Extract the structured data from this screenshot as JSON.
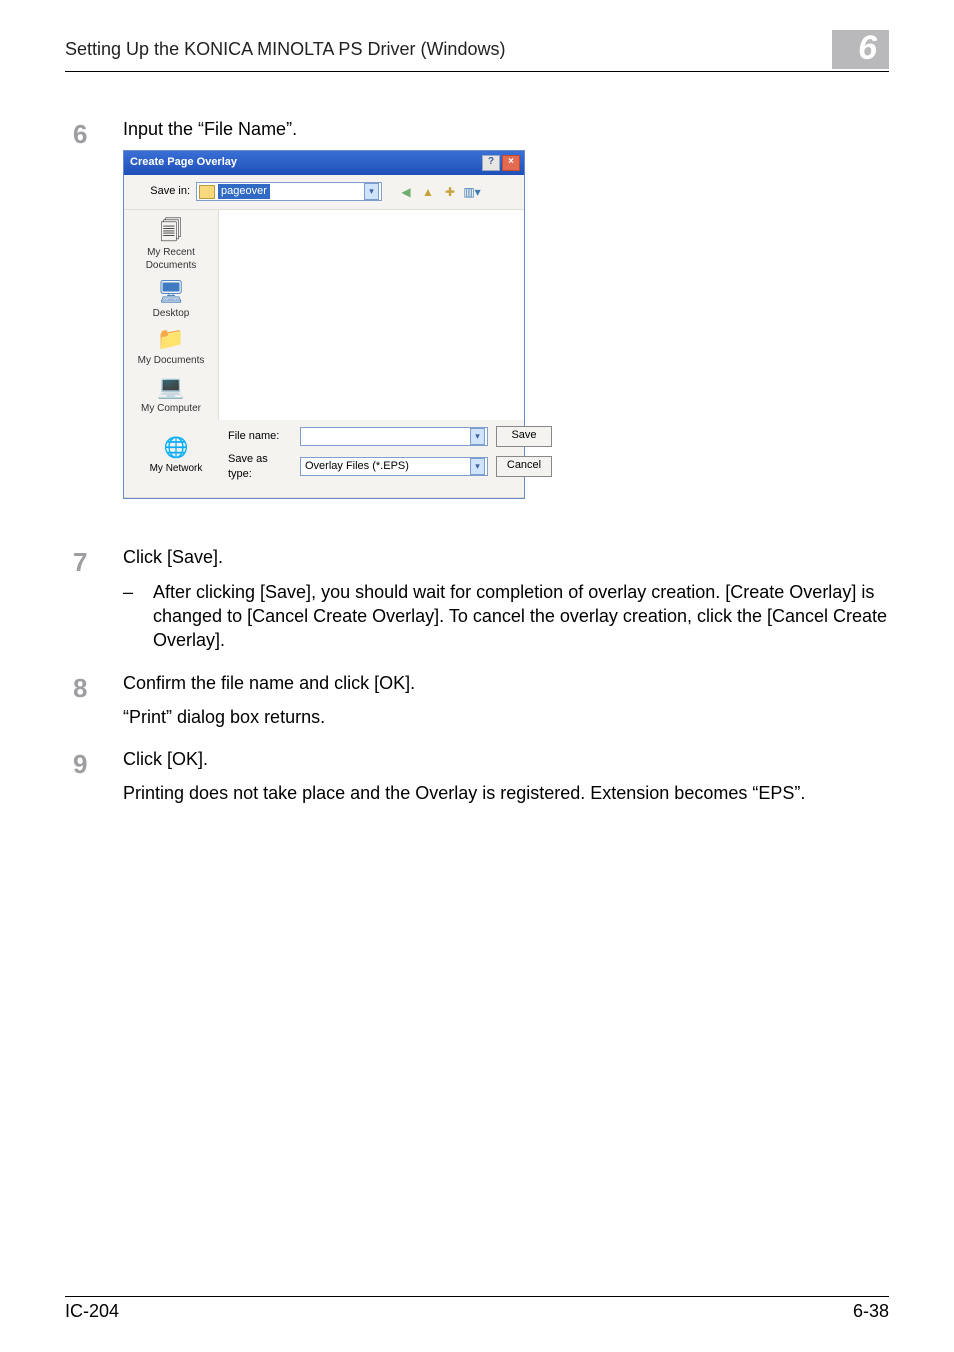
{
  "header": {
    "title": "Setting Up the KONICA MINOLTA PS Driver (Windows)",
    "chapter": "6"
  },
  "steps": {
    "6": {
      "num": "6",
      "text": "Input the “File Name”."
    },
    "7": {
      "num": "7",
      "text": "Click [Save].",
      "bullet": "After clicking [Save], you should wait for completion of overlay creation. [Create Overlay] is changed to [Cancel Create Overlay]. To cancel the overlay creation, click the [Cancel Create Overlay]."
    },
    "8": {
      "num": "8",
      "text": "Confirm the file name and click [OK].",
      "extra": "“Print” dialog box returns."
    },
    "9": {
      "num": "9",
      "text": "Click [OK].",
      "extra": "Printing does not take place and the Overlay is registered. Extension becomes “EPS”."
    }
  },
  "dialog": {
    "title": "Create Page Overlay",
    "savein_label": "Save in:",
    "savein_value": "pageover",
    "places": {
      "recent": "My Recent Documents",
      "desktop": "Desktop",
      "mydocs": "My Documents",
      "mycomp": "My Computer",
      "mynet": "My Network"
    },
    "filename_label": "File name:",
    "filename_value": "",
    "type_label": "Save as type:",
    "type_value": "Overlay Files (*.EPS)",
    "save_btn": "Save",
    "cancel_btn": "Cancel"
  },
  "footer": {
    "left": "IC-204",
    "right": "6-38"
  }
}
